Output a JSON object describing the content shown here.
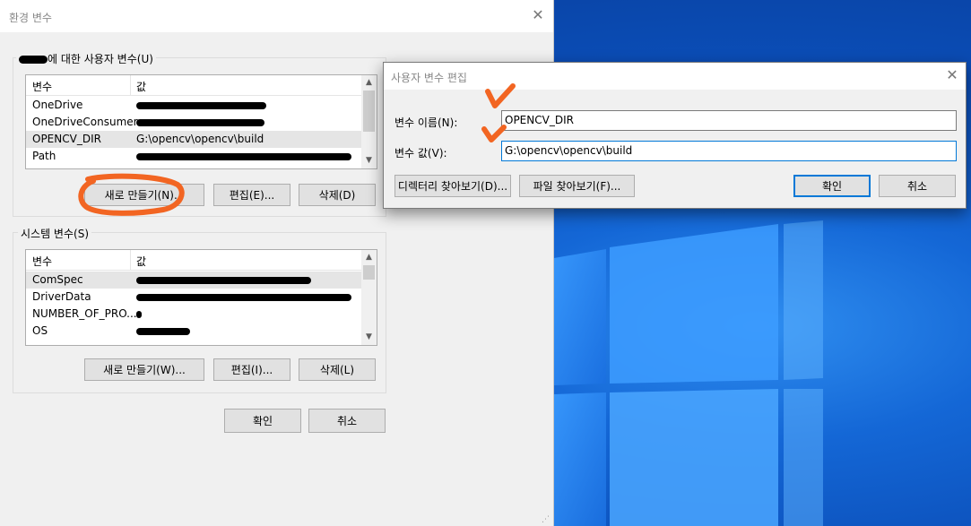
{
  "main_dialog": {
    "title": "환경 변수",
    "user_group_label": "에 대한 사용자 변수(U)",
    "system_group_label": "시스템 변수(S)",
    "user_vars": {
      "columns": [
        "변수",
        "값"
      ],
      "rows": [
        {
          "name": "OneDrive",
          "value_redacted": true
        },
        {
          "name": "OneDriveConsumer",
          "value_redacted": true
        },
        {
          "name": "OPENCV_DIR",
          "value": "G:\\opencv\\opencv\\build",
          "selected": true
        },
        {
          "name": "Path",
          "value_redacted": true
        }
      ]
    },
    "system_vars": {
      "columns": [
        "변수",
        "값"
      ],
      "rows": [
        {
          "name": "ComSpec",
          "value_redacted": true,
          "selected": true
        },
        {
          "name": "DriverData",
          "value_redacted": true
        },
        {
          "name": "NUMBER_OF_PRO...",
          "value_redacted": true
        },
        {
          "name": "OS",
          "value_redacted": true
        }
      ]
    },
    "user_buttons": {
      "new": "새로 만들기(N)...",
      "edit": "편집(E)...",
      "delete": "삭제(D)"
    },
    "system_buttons": {
      "new": "새로 만들기(W)...",
      "edit": "편집(I)...",
      "delete": "삭제(L)"
    },
    "ok": "확인",
    "cancel": "취소"
  },
  "edit_dialog": {
    "title": "사용자 변수 편집",
    "name_label": "변수 이름(N):",
    "name_value": "OPENCV_DIR",
    "value_label": "변수 값(V):",
    "value_value": "G:\\opencv\\opencv\\build",
    "browse_dir": "디렉터리 찾아보기(D)...",
    "browse_file": "파일 찾아보기(F)...",
    "ok": "확인",
    "cancel": "취소"
  },
  "colors": {
    "annotation": "#f26522",
    "focus": "#0078d7",
    "dialog_bg": "#f0f0f0",
    "desktop": "#0b4eb8"
  },
  "icons": [
    "close-icon",
    "scroll-up-icon",
    "scroll-down-icon",
    "windows-logo",
    "check-mark-annotation",
    "circle-annotation"
  ]
}
